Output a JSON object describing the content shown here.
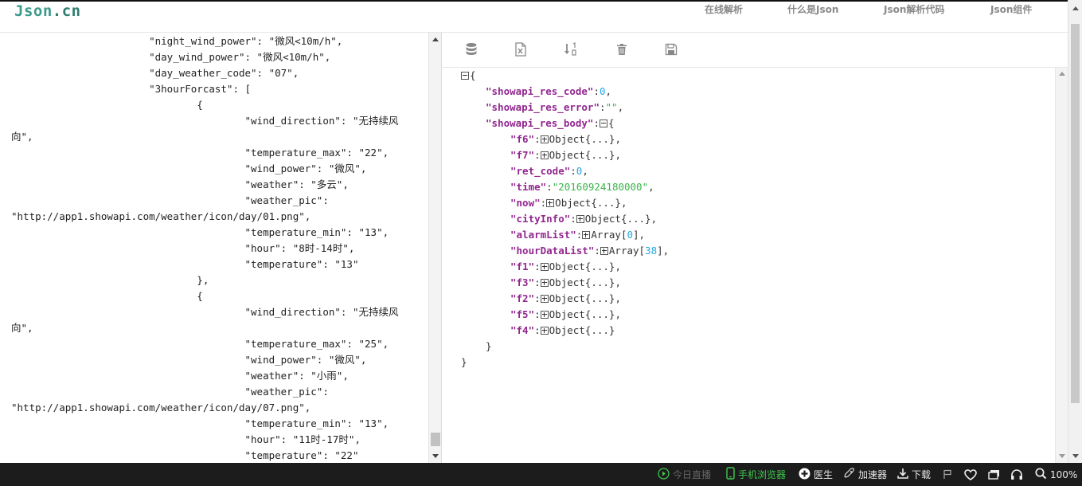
{
  "header": {
    "logo_main": "Json",
    "logo_suffix": ".cn",
    "nav": [
      "在线解析",
      "什么是Json",
      "Json解析代码",
      "Json组件"
    ]
  },
  "source_lines": [
    "                       \"night_wind_power\": \"微风<10m/h\",",
    "                       \"day_wind_power\": \"微风<10m/h\",",
    "                       \"day_weather_code\": \"07\",",
    "                       \"3hourForcast\": [",
    "                               {",
    "                                       \"wind_direction\": \"无持续风",
    "向\",",
    "                                       \"temperature_max\": \"22\",",
    "                                       \"wind_power\": \"微风\",",
    "                                       \"weather\": \"多云\",",
    "                                       \"weather_pic\":",
    "\"http://app1.showapi.com/weather/icon/day/01.png\",",
    "                                       \"temperature_min\": \"13\",",
    "                                       \"hour\": \"8时-14时\",",
    "                                       \"temperature\": \"13\"",
    "                               },",
    "                               {",
    "                                       \"wind_direction\": \"无持续风",
    "向\",",
    "                                       \"temperature_max\": \"25\",",
    "                                       \"wind_power\": \"微风\",",
    "                                       \"weather\": \"小雨\",",
    "                                       \"weather_pic\":",
    "\"http://app1.showapi.com/weather/icon/day/07.png\",",
    "                                       \"temperature_min\": \"13\",",
    "                                       \"hour\": \"11时-17时\",",
    "                                       \"temperature\": \"22\""
  ],
  "tree": {
    "open_brace": "{",
    "close_brace": "}",
    "res_code": {
      "key": "\"showapi_res_code\"",
      "value": "0"
    },
    "res_error": {
      "key": "\"showapi_res_error\"",
      "value": "\"\""
    },
    "res_body": {
      "key": "\"showapi_res_body\""
    },
    "body_items": [
      {
        "key": "\"f6\"",
        "type": "collapsed",
        "value": "Object{...}",
        "trail": ","
      },
      {
        "key": "\"f7\"",
        "type": "collapsed",
        "value": "Object{...}",
        "trail": ","
      },
      {
        "key": "\"ret_code\"",
        "type": "number",
        "value": "0",
        "trail": ","
      },
      {
        "key": "\"time\"",
        "type": "string",
        "value": "\"20160924180000\"",
        "trail": ","
      },
      {
        "key": "\"now\"",
        "type": "collapsed",
        "value": "Object{...}",
        "trail": ","
      },
      {
        "key": "\"cityInfo\"",
        "type": "collapsed",
        "value": "Object{...}",
        "trail": ","
      },
      {
        "key": "\"alarmList\"",
        "type": "array",
        "value_pre": "Array[",
        "value_num": "0",
        "value_post": "]",
        "trail": ","
      },
      {
        "key": "\"hourDataList\"",
        "type": "array",
        "value_pre": "Array[",
        "value_num": "38",
        "value_post": "]",
        "trail": ","
      },
      {
        "key": "\"f1\"",
        "type": "collapsed",
        "value": "Object{...}",
        "trail": ","
      },
      {
        "key": "\"f3\"",
        "type": "collapsed",
        "value": "Object{...}",
        "trail": ","
      },
      {
        "key": "\"f2\"",
        "type": "collapsed",
        "value": "Object{...}",
        "trail": ","
      },
      {
        "key": "\"f5\"",
        "type": "collapsed",
        "value": "Object{...}",
        "trail": ","
      },
      {
        "key": "\"f4\"",
        "type": "collapsed",
        "value": "Object{...}",
        "trail": ""
      }
    ]
  },
  "toolbar_icons": [
    "database-icon",
    "excel-icon",
    "sort-icon",
    "trash-icon",
    "save-icon"
  ],
  "statusbar": {
    "live": "今日直播",
    "mobile_browser": "手机浏览器",
    "doctor": "医生",
    "accelerator": "加速器",
    "download": "下载",
    "zoom": "100%"
  },
  "colors": {
    "key": "#92278f",
    "number": "#25aae2",
    "string": "#3ab54a",
    "logo": "#3d9a8b",
    "mobile_browser": "#3ec74f"
  }
}
